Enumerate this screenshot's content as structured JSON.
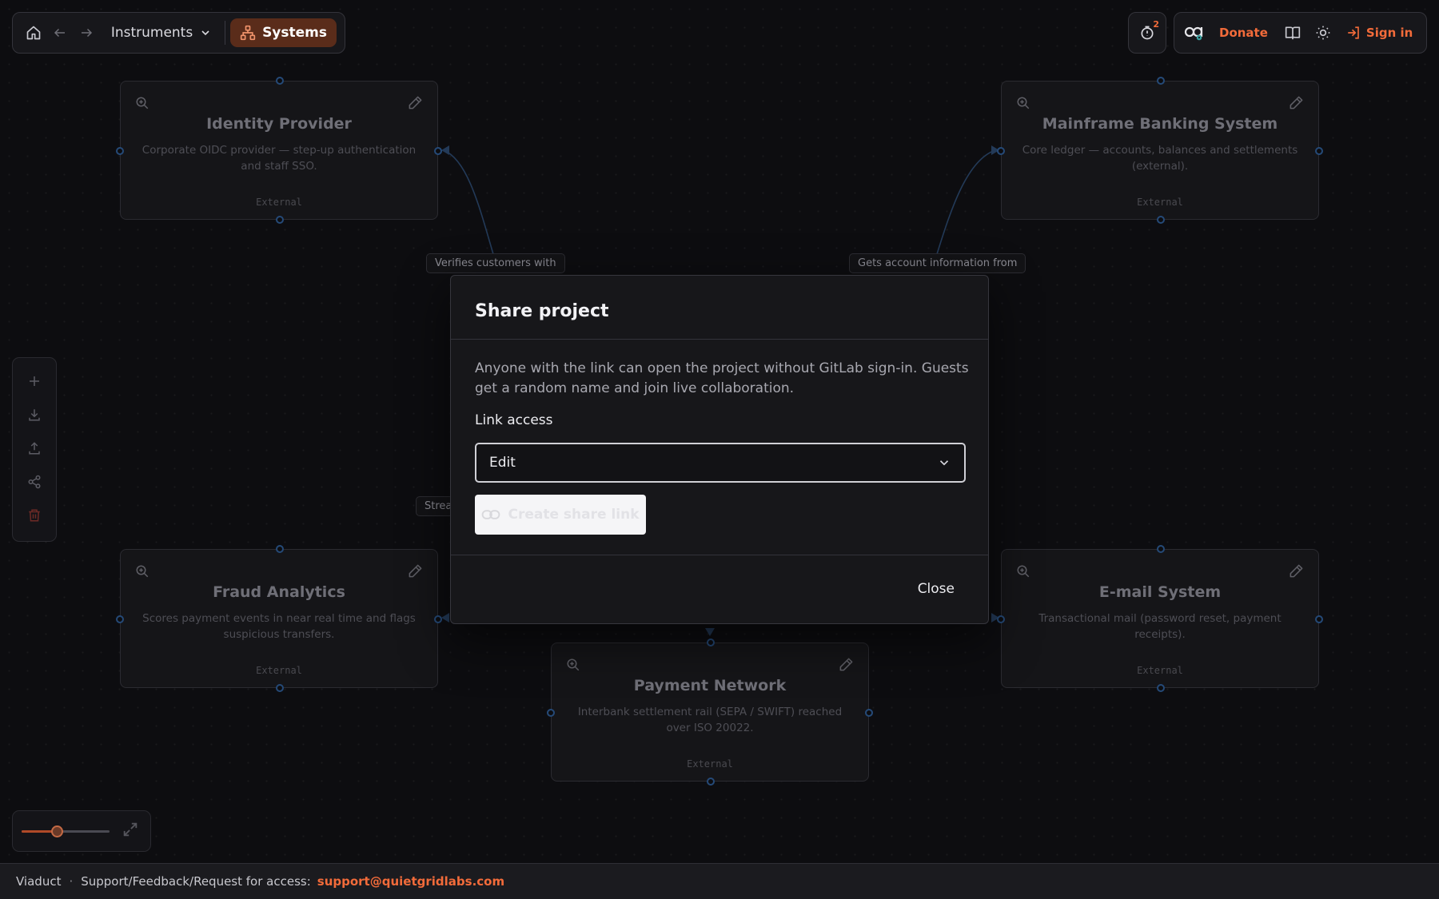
{
  "header": {
    "project_name": "Instruments",
    "view_chip": "Systems",
    "notification_count": "2",
    "donate_label": "Donate",
    "signin_label": "Sign in"
  },
  "canvas": {
    "nodes": [
      {
        "title": "Identity Provider",
        "description": "Corporate OIDC provider — step-up authentication and staff SSO.",
        "tag": "External"
      },
      {
        "title": "Mainframe Banking System",
        "description": "Core ledger — accounts, balances and settlements (external).",
        "tag": "External"
      },
      {
        "title": "Fraud Analytics",
        "description": "Scores payment events in near real time and flags suspicious transfers.",
        "tag": "External"
      },
      {
        "title": "E-mail System",
        "description": "Transactional mail (password reset, payment receipts).",
        "tag": "External"
      },
      {
        "title": "Payment Network",
        "description": "Interbank settlement rail (SEPA / SWIFT) reached over ISO 20022.",
        "tag": "External"
      }
    ],
    "edge_labels": [
      "Verifies customers with",
      "Gets account information from",
      "Strea"
    ]
  },
  "modal": {
    "title": "Share project",
    "description": "Anyone with the link can open the project without GitLab sign-in. Guests get a random name and join live collaboration.",
    "link_access_label": "Link access",
    "link_access_value": "Edit",
    "create_button_label": "Create share link",
    "close_label": "Close"
  },
  "zoom": {
    "level_fraction": 0.4
  },
  "footer": {
    "app_name": "Viaduct",
    "separator": "·",
    "support_text": "Support/Feedback/Request for access:",
    "email": "support@quietgridlabs.com"
  },
  "colors": {
    "accent": "#f26b3a",
    "background": "#0d0d10",
    "modal_bg": "#17171a"
  }
}
